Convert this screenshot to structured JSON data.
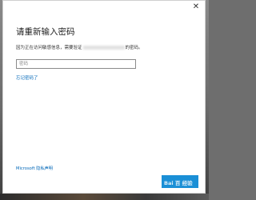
{
  "dialog": {
    "close_glyph": "✕",
    "title": "请重新输入密码",
    "description_before": "因为正在访问敏感信息，需要验证",
    "description_after": "的密码。",
    "password_placeholder": "密码",
    "forgot_link": "忘记密码了",
    "privacy_link": "Microsoft 隐私声明",
    "ok_button": "",
    "watermark": "Bai 百 经验"
  },
  "colors": {
    "link": "#0067b8",
    "accent": "#1a8fd6"
  },
  "icons": {
    "close": "close-icon"
  }
}
